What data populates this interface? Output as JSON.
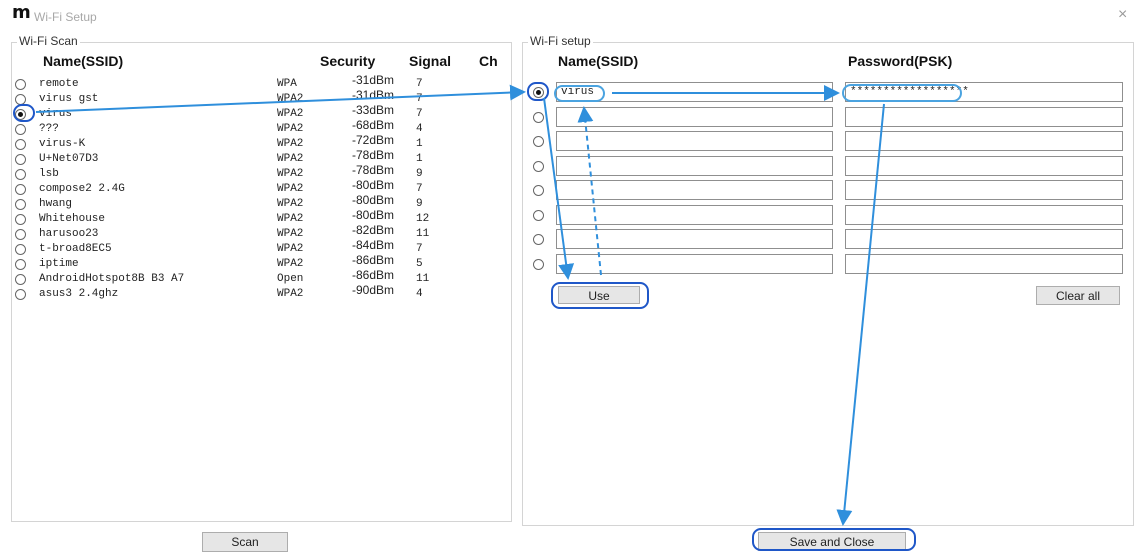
{
  "window": {
    "logo_text": "m",
    "title": "Wi-Fi Setup",
    "close_glyph": "×"
  },
  "scan": {
    "group_label": "Wi-Fi Scan",
    "headers": {
      "name": "Name(SSID)",
      "security": "Security",
      "signal": "Signal",
      "channel": "Ch"
    },
    "selected_index": 2,
    "networks": [
      {
        "ssid": "remote",
        "security": "WPA",
        "signal": "-31dBm",
        "ch": "7"
      },
      {
        "ssid": "virus gst",
        "security": "WPA2",
        "signal": "-31dBm",
        "ch": "7"
      },
      {
        "ssid": "virus",
        "security": "WPA2",
        "signal": "-33dBm",
        "ch": "7"
      },
      {
        "ssid": "???",
        "security": "WPA2",
        "signal": "-68dBm",
        "ch": "4"
      },
      {
        "ssid": "virus-K",
        "security": "WPA2",
        "signal": "-72dBm",
        "ch": "1"
      },
      {
        "ssid": "U+Net07D3",
        "security": "WPA2",
        "signal": "-78dBm",
        "ch": "1"
      },
      {
        "ssid": "lsb",
        "security": "WPA2",
        "signal": "-78dBm",
        "ch": "9"
      },
      {
        "ssid": "compose2 2.4G",
        "security": "WPA2",
        "signal": "-80dBm",
        "ch": "7"
      },
      {
        "ssid": "hwang",
        "security": "WPA2",
        "signal": "-80dBm",
        "ch": "9"
      },
      {
        "ssid": "Whitehouse",
        "security": "WPA2",
        "signal": "-80dBm",
        "ch": "12"
      },
      {
        "ssid": "harusoo23",
        "security": "WPA2",
        "signal": "-82dBm",
        "ch": "11"
      },
      {
        "ssid": "t-broad8EC5",
        "security": "WPA2",
        "signal": "-84dBm",
        "ch": "7"
      },
      {
        "ssid": "iptime",
        "security": "WPA2",
        "signal": "-86dBm",
        "ch": "5"
      },
      {
        "ssid": "AndroidHotspot8B B3 A7",
        "security": "Open",
        "signal": "-86dBm",
        "ch": "11"
      },
      {
        "ssid": "asus3 2.4ghz",
        "security": "WPA2",
        "signal": "-90dBm",
        "ch": "4"
      }
    ],
    "scan_button": "Scan"
  },
  "setup": {
    "group_label": "Wi-Fi setup",
    "headers": {
      "name": "Name(SSID)",
      "password": "Password(PSK)"
    },
    "selected_index": 0,
    "slots": [
      {
        "ssid": "virus",
        "psk": "******************"
      },
      {
        "ssid": "",
        "psk": ""
      },
      {
        "ssid": "",
        "psk": ""
      },
      {
        "ssid": "",
        "psk": ""
      },
      {
        "ssid": "",
        "psk": ""
      },
      {
        "ssid": "",
        "psk": ""
      },
      {
        "ssid": "",
        "psk": ""
      },
      {
        "ssid": "",
        "psk": ""
      }
    ],
    "use_button": "Use",
    "clear_all_button": "Clear all",
    "save_close_button": "Save and Close"
  },
  "colors": {
    "highlight_dark": "#1f57c8",
    "highlight_light": "#4aa3e0",
    "arrow": "#2f8fdc"
  }
}
